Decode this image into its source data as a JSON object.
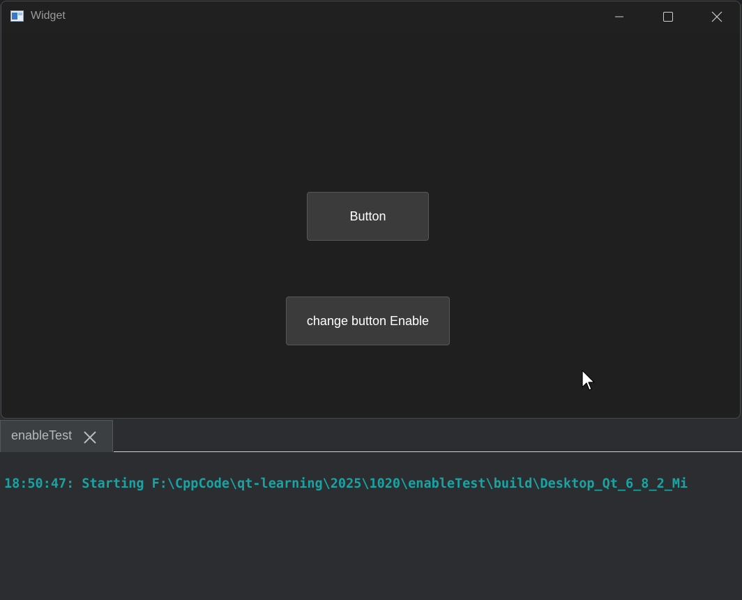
{
  "window": {
    "title": "Widget",
    "icons": {
      "app": "app-window-icon",
      "minimize": "minimize-icon",
      "maximize": "maximize-icon",
      "close": "close-icon"
    }
  },
  "widget": {
    "button_label": "Button",
    "toggle_button_label": "change button Enable"
  },
  "output_panel": {
    "tab_label": "enableTest",
    "tab_close_icon": "close-icon",
    "log_line": "18:50:47: Starting F:\\CppCode\\qt-learning\\2025\\1020\\enableTest\\build\\Desktop_Qt_6_8_2_Mi"
  },
  "colors": {
    "window_bg": "#1f1f1f",
    "button_bg": "#3b3b3b",
    "output_bg": "#2b2d30",
    "log_text": "#1aa3a3"
  }
}
